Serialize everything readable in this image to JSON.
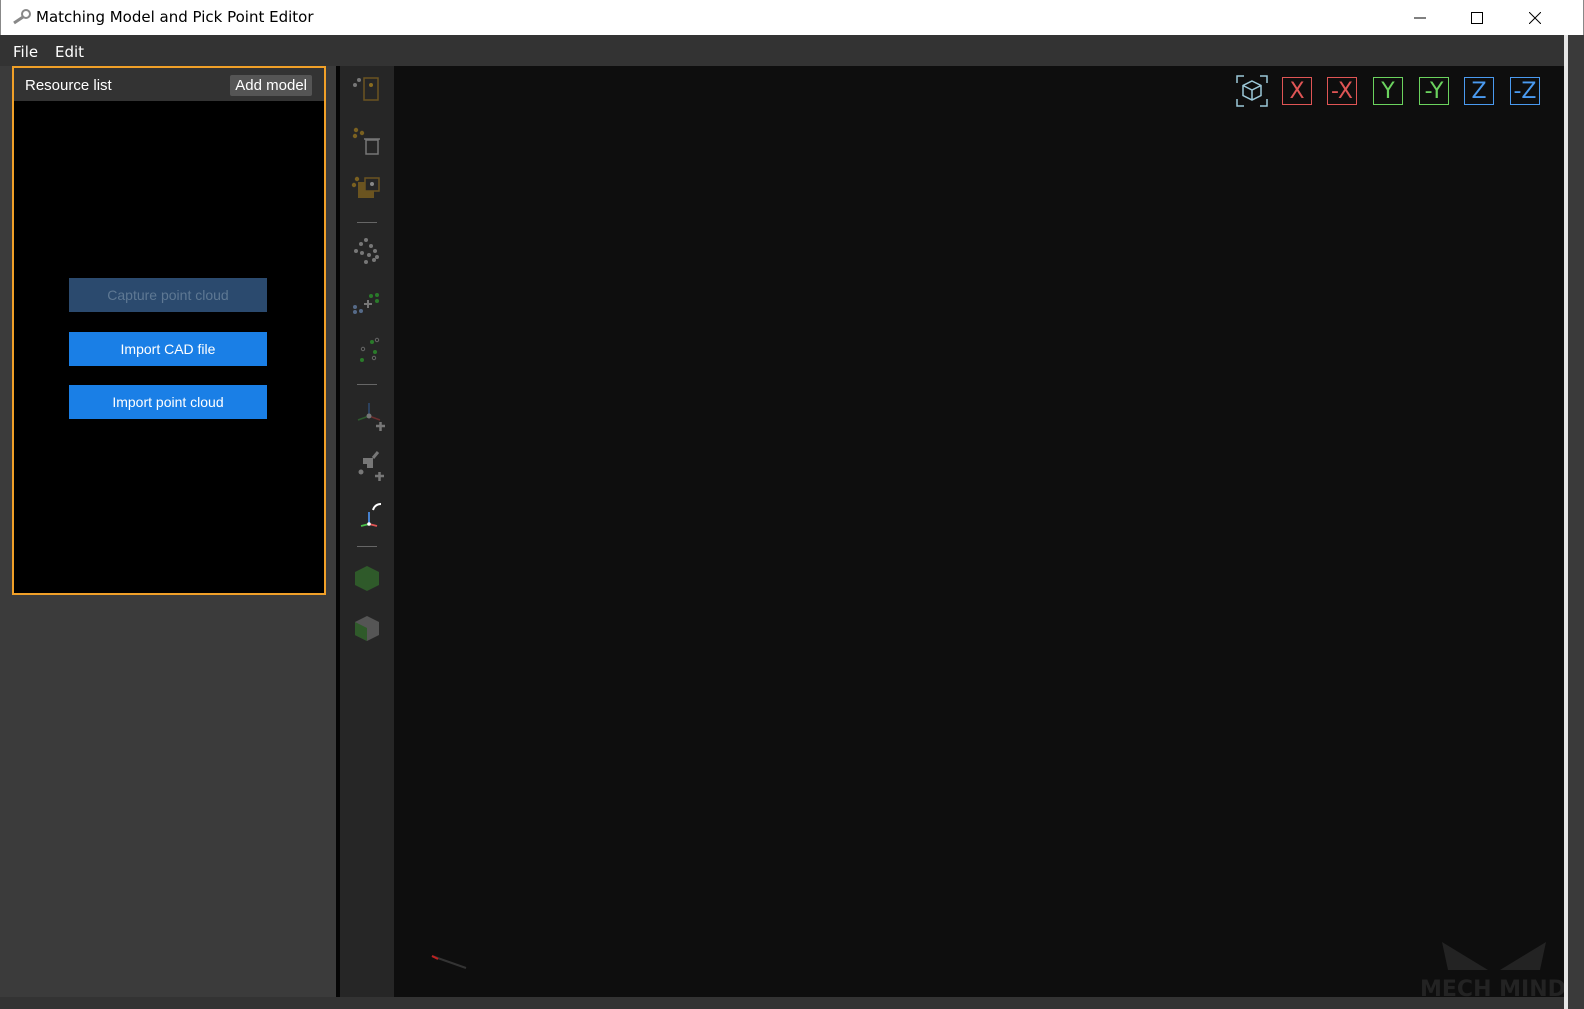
{
  "window": {
    "title": "Matching Model and Pick Point Editor",
    "minimize": "minimize",
    "maximize": "maximize",
    "close": "close"
  },
  "menu": {
    "file": "File",
    "edit": "Edit"
  },
  "resource_list": {
    "title": "Resource list",
    "add_model": "Add model",
    "capture": "Capture point cloud",
    "import_cad": "Import CAD file",
    "import_cloud": "Import point cloud"
  },
  "view_buttons": [
    {
      "label": "X",
      "color": "#e05555"
    },
    {
      "label": "-X",
      "color": "#e05555"
    },
    {
      "label": "Y",
      "color": "#6bd35e"
    },
    {
      "label": "-Y",
      "color": "#6bd35e"
    },
    {
      "label": "Z",
      "color": "#4a9af0"
    },
    {
      "label": "-Z",
      "color": "#4a9af0"
    }
  ],
  "watermark": "MECH MIND",
  "colors": {
    "accent": "#f0a028",
    "primary": "#1a7fe6"
  }
}
